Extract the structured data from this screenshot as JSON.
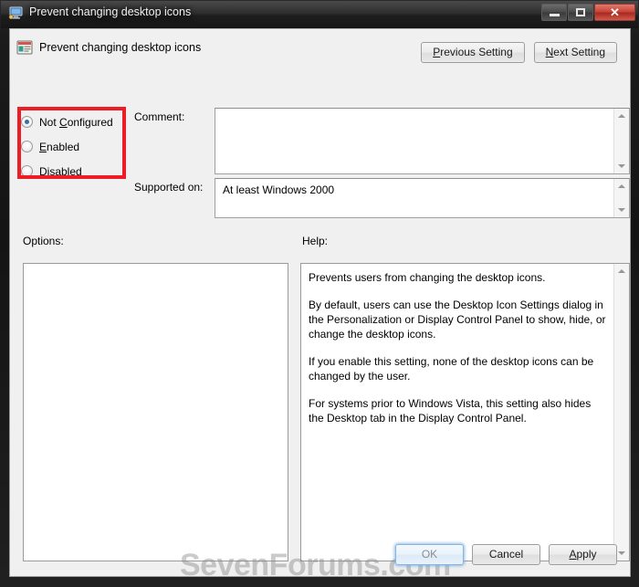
{
  "window": {
    "title": "Prevent changing desktop icons",
    "title_icon": "monitor-icon",
    "controls": {
      "minimize": "Minimize",
      "restore": "Restore",
      "close": "Close",
      "close_glyph": "✕"
    }
  },
  "header": {
    "icon": "policy-setting-icon",
    "title": "Prevent changing desktop icons",
    "previous_button": "Previous Setting",
    "previous_button_prefix": "P",
    "previous_button_rest": "revious Setting",
    "next_button": "Next Setting",
    "next_button_prefix": "N",
    "next_button_rest": "ext Setting"
  },
  "state_options": {
    "selected": "Not Configured",
    "items": [
      {
        "label": "Not Configured",
        "pre": "Not ",
        "key": "C",
        "post": "onfigured",
        "checked": true
      },
      {
        "label": "Enabled",
        "pre": "",
        "key": "E",
        "post": "nabled",
        "checked": false
      },
      {
        "label": "Disabled",
        "pre": "",
        "key": "D",
        "post": "isabled",
        "checked": false
      }
    ],
    "highlight_color": "#ee1c25"
  },
  "comment": {
    "label": "Comment:",
    "value": "",
    "placeholder": ""
  },
  "supported_on": {
    "label": "Supported on:",
    "value": "At least Windows 2000"
  },
  "options": {
    "label": "Options:",
    "content": ""
  },
  "help": {
    "label": "Help:",
    "paragraphs": [
      "Prevents users from changing the desktop icons.",
      "By default, users can use the Desktop Icon Settings dialog in the Personalization or Display Control Panel to show, hide, or change the desktop icons.",
      "If you enable this setting, none of the desktop icons can be changed by the user.",
      "For systems prior to Windows Vista, this setting also hides the Desktop tab in the Display Control Panel."
    ]
  },
  "footer": {
    "ok": "OK",
    "ok_enabled": false,
    "cancel": "Cancel",
    "apply": "Apply",
    "apply_prefix": "A",
    "apply_rest": "pply"
  },
  "watermark": {
    "text": "SevenForums.com"
  }
}
